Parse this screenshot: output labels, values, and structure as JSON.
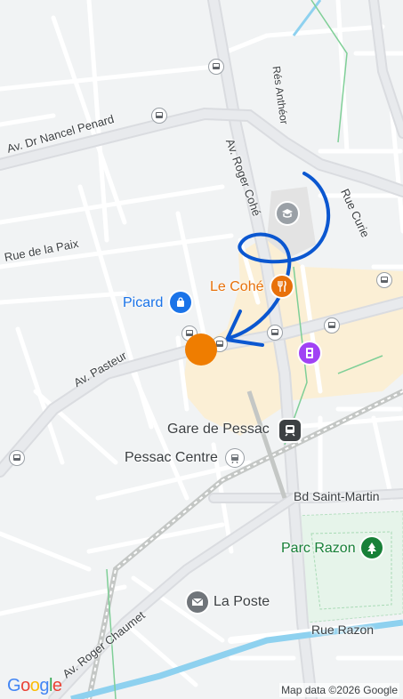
{
  "map": {
    "streets": [
      {
        "id": "dr-nancel-penard",
        "label": "Av. Dr Nancel Penard"
      },
      {
        "id": "roger-cohe",
        "label": "Av. Roger Cohé"
      },
      {
        "id": "res-antheor",
        "label": "Rés Anthéor"
      },
      {
        "id": "rue-curie",
        "label": "Rue Curie"
      },
      {
        "id": "rue-de-la-paix",
        "label": "Rue de la Paix"
      },
      {
        "id": "av-pasteur",
        "label": "Av. Pasteur"
      },
      {
        "id": "bd-saint-martin",
        "label": "Bd Saint-Martin"
      },
      {
        "id": "roger-chaumet",
        "label": "Av. Roger Chaumet"
      },
      {
        "id": "rue-razon",
        "label": "Rue Razon"
      }
    ],
    "places": [
      {
        "id": "picard",
        "label": "Picard",
        "icon": "shopping-bag-icon",
        "color": "#1a73e8"
      },
      {
        "id": "le-cohe",
        "label": "Le Cohé",
        "icon": "restaurant-icon",
        "color": "#e8710a"
      },
      {
        "id": "cinema",
        "label": "",
        "icon": "cinema-icon",
        "color": "#a142f4"
      },
      {
        "id": "school",
        "label": "",
        "icon": "school-icon",
        "color": "#9aa0a6"
      },
      {
        "id": "gare-de-pessac",
        "label": "Gare de Pessac",
        "icon": "train-station-icon",
        "color": "#3c4043"
      },
      {
        "id": "pessac-centre",
        "label": "Pessac Centre",
        "icon": "tram-icon",
        "color": "#70757a"
      },
      {
        "id": "parc-razon",
        "label": "Parc Razon",
        "icon": "tree-icon",
        "color": "#188038"
      },
      {
        "id": "la-poste",
        "label": "La Poste",
        "icon": "mail-icon",
        "color": "#70757a"
      }
    ],
    "bus_stop_icon": "bus-stop-icon",
    "location_marker_color": "#ef7d00",
    "drawn_arrow_color": "#0b57d0",
    "colors": {
      "background": "#f1f3f4",
      "road": "#ffffff",
      "major_road": "#dadce0",
      "commercial_area": "#fbefd5",
      "park": "#e6f4ea",
      "water": "#8ed1ef",
      "rail": "#c4c7c5"
    }
  },
  "branding": {
    "logo": "Google",
    "attribution": "Map data ©2026 Google"
  }
}
